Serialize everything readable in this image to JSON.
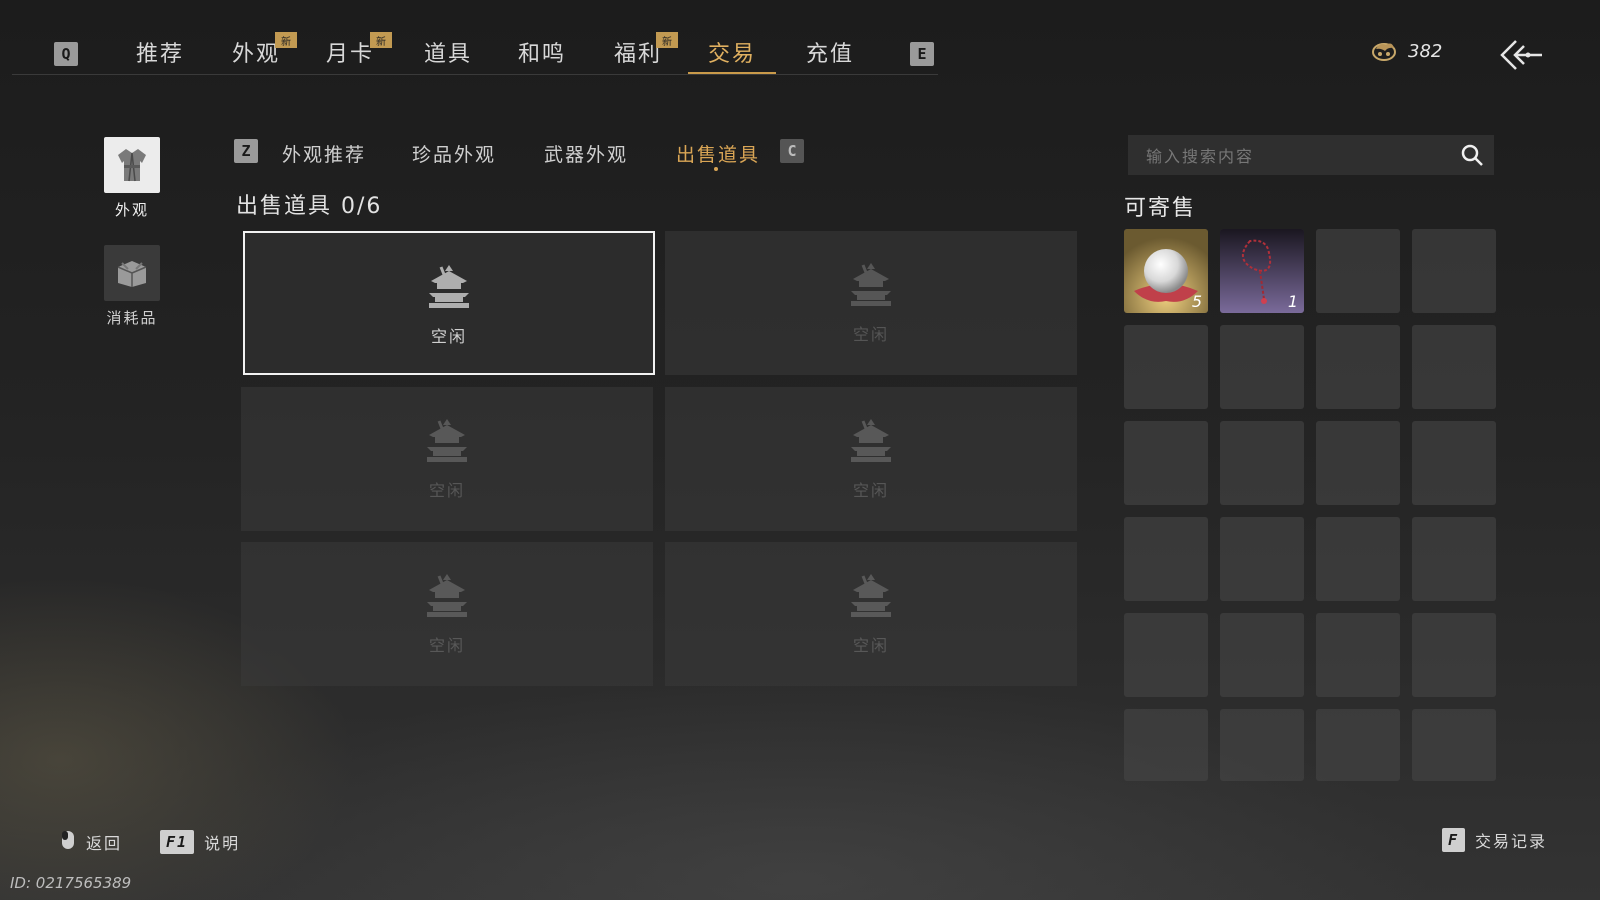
{
  "nav": {
    "left_key": "Q",
    "right_key": "E",
    "tabs": [
      {
        "label": "推荐",
        "badge": ""
      },
      {
        "label": "外观",
        "badge": "新"
      },
      {
        "label": "月卡",
        "badge": "新"
      },
      {
        "label": "道具",
        "badge": ""
      },
      {
        "label": "和鸣",
        "badge": ""
      },
      {
        "label": "福利",
        "badge": "新"
      },
      {
        "label": "交易",
        "badge": "",
        "active": true
      },
      {
        "label": "充值",
        "badge": ""
      }
    ],
    "currency": {
      "icon": "coin-dragon-icon",
      "value": "382"
    },
    "back_icon": "back-arrow-icon"
  },
  "sidebar": {
    "items": [
      {
        "label": "外观",
        "icon": "robe-icon",
        "active": true
      },
      {
        "label": "消耗品",
        "icon": "package-icon",
        "active": false
      }
    ]
  },
  "subtabs": {
    "left_key": "Z",
    "right_key": "C",
    "items": [
      {
        "label": "外观推荐"
      },
      {
        "label": "珍品外观"
      },
      {
        "label": "武器外观"
      },
      {
        "label": "出售道具",
        "active": true
      }
    ]
  },
  "sell": {
    "title": "出售道具 0/6",
    "slots": [
      {
        "label": "空闲",
        "selected": true
      },
      {
        "label": "空闲",
        "selected": false
      },
      {
        "label": "空闲",
        "selected": false
      },
      {
        "label": "空闲",
        "selected": false
      },
      {
        "label": "空闲",
        "selected": false
      },
      {
        "label": "空闲",
        "selected": false
      }
    ]
  },
  "inventory": {
    "search_placeholder": "输入搜索内容",
    "title": "可寄售",
    "items": [
      {
        "name": "pearl",
        "icon": "pearl-icon",
        "count": "5"
      },
      {
        "name": "red-bead-string",
        "icon": "bead-string-icon",
        "count": "1"
      }
    ],
    "total_cells": 24
  },
  "footer": {
    "back_label": "返回",
    "help_key": "F1",
    "help_label": "说明",
    "record_key": "F",
    "record_label": "交易记录",
    "id_text": "ID: 0217565389"
  },
  "colors": {
    "accent": "#d9a555",
    "badge": "#c29a52",
    "slot_bg": "#3a3a3a"
  }
}
